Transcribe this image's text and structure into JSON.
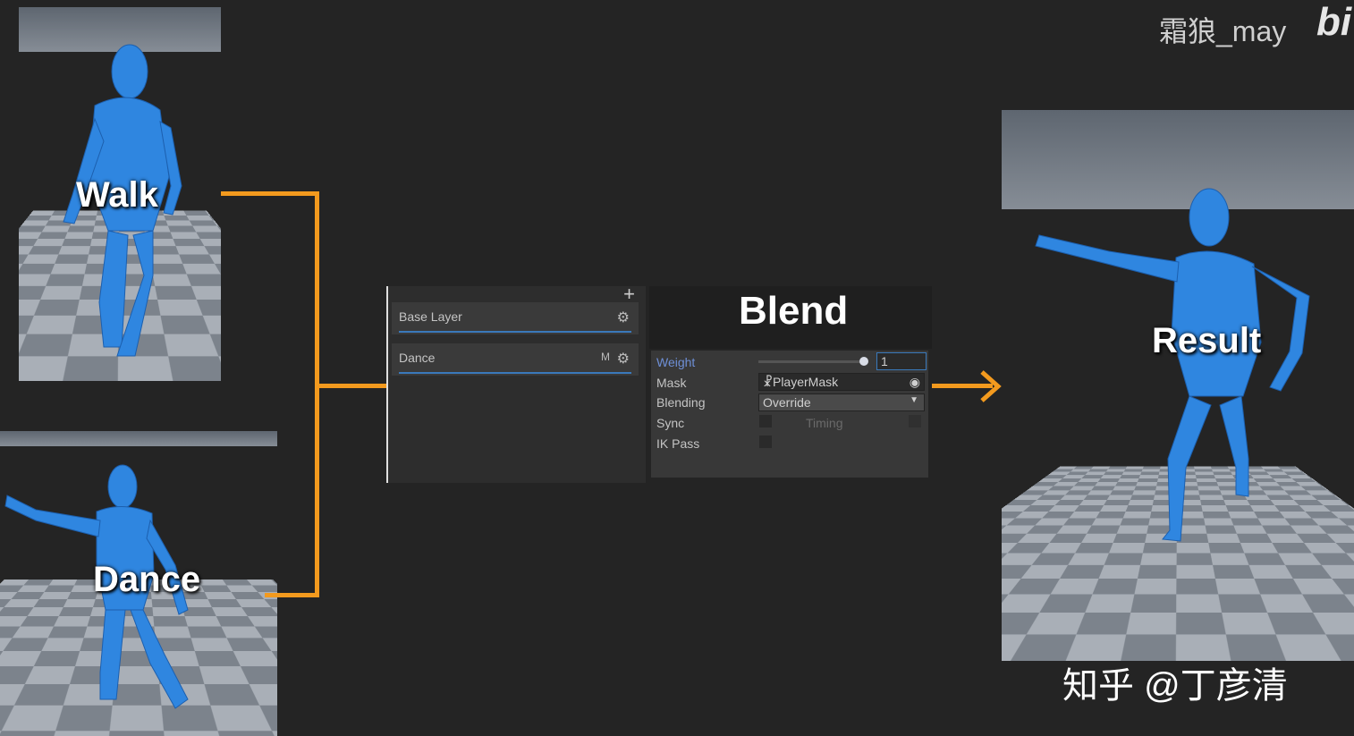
{
  "labels": {
    "walk": "Walk",
    "dance": "Dance",
    "result": "Result"
  },
  "layers": {
    "base_layer": "Base Layer",
    "dance_layer": "Dance",
    "m_badge": "M",
    "add_label": "+"
  },
  "blend": {
    "title": "Blend",
    "weight_label": "Weight",
    "weight_value": "1",
    "weight_slider": 1,
    "mask_label": "Mask",
    "mask_value": "PlayerMask",
    "blending_label": "Blending",
    "blending_value": "Override",
    "sync_label": "Sync",
    "timing_label": "Timing",
    "ikpass_label": "IK Pass"
  },
  "watermark": {
    "author": "霜狼_may",
    "zhihu": "知乎 @丁彦清",
    "logo": "bi"
  },
  "colors": {
    "connector": "#f39a1e",
    "figure": "#2f86e0",
    "weight_accent": "#6e8fd6"
  }
}
